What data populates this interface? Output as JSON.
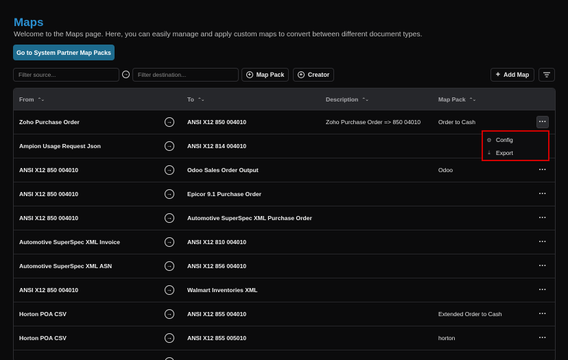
{
  "page": {
    "title": "Maps",
    "subtitle": "Welcome to the Maps page. Here, you can easily manage and apply custom maps to convert between different document types.",
    "partner_button": "Go to System Partner Map Packs"
  },
  "toolbar": {
    "source_placeholder": "Filter source...",
    "destination_placeholder": "Filter destination...",
    "map_pack_label": "Map Pack",
    "creator_label": "Creator",
    "add_map_label": "Add Map"
  },
  "table": {
    "headers": {
      "from": "From",
      "to": "To",
      "description": "Description",
      "map_pack": "Map Pack"
    },
    "rows": [
      {
        "from": "Zoho Purchase Order",
        "to": "ANSI X12 850 004010",
        "description": "Zoho Purchase Order => 850 04010",
        "map_pack": "Order to Cash"
      },
      {
        "from": "Ampion Usage Request Json",
        "to": "ANSI X12 814 004010",
        "description": "",
        "map_pack": ""
      },
      {
        "from": "ANSI X12 850 004010",
        "to": "Odoo Sales Order Output",
        "description": "",
        "map_pack": "Odoo"
      },
      {
        "from": "ANSI X12 850 004010",
        "to": "Epicor 9.1 Purchase Order",
        "description": "",
        "map_pack": ""
      },
      {
        "from": "ANSI X12 850 004010",
        "to": "Automotive SuperSpec XML Purchase Order",
        "description": "",
        "map_pack": ""
      },
      {
        "from": "Automotive SuperSpec XML Invoice",
        "to": "ANSI X12 810 004010",
        "description": "",
        "map_pack": ""
      },
      {
        "from": "Automotive SuperSpec XML ASN",
        "to": "ANSI X12 856 004010",
        "description": "",
        "map_pack": ""
      },
      {
        "from": "ANSI X12 850 004010",
        "to": "Walmart Inventories XML",
        "description": "",
        "map_pack": ""
      },
      {
        "from": "Horton POA CSV",
        "to": "ANSI X12 855 004010",
        "description": "",
        "map_pack": "Extended Order to Cash"
      },
      {
        "from": "Horton POA CSV",
        "to": "ANSI X12 855 005010",
        "description": "",
        "map_pack": "horton"
      }
    ]
  },
  "row_menu": {
    "config_label": "Config",
    "export_label": "Export"
  },
  "colors": {
    "background": "#0b0b0c",
    "title": "#2a8fd0",
    "primary_button": "#1d6b8e",
    "header_bg": "#26272b",
    "highlight_border": "#d40000"
  },
  "icons": {
    "arrow_separator": "arrow-right-circle-icon",
    "map_pack": "plus-circle-icon",
    "creator": "plus-circle-icon",
    "add_map": "plus-icon",
    "filter": "filter-lines-icon",
    "sort": "chevron-up-down-icon",
    "row_arrow": "arrow-right-circle-icon",
    "more": "ellipsis-icon",
    "config": "gear-icon",
    "export": "download-icon"
  }
}
